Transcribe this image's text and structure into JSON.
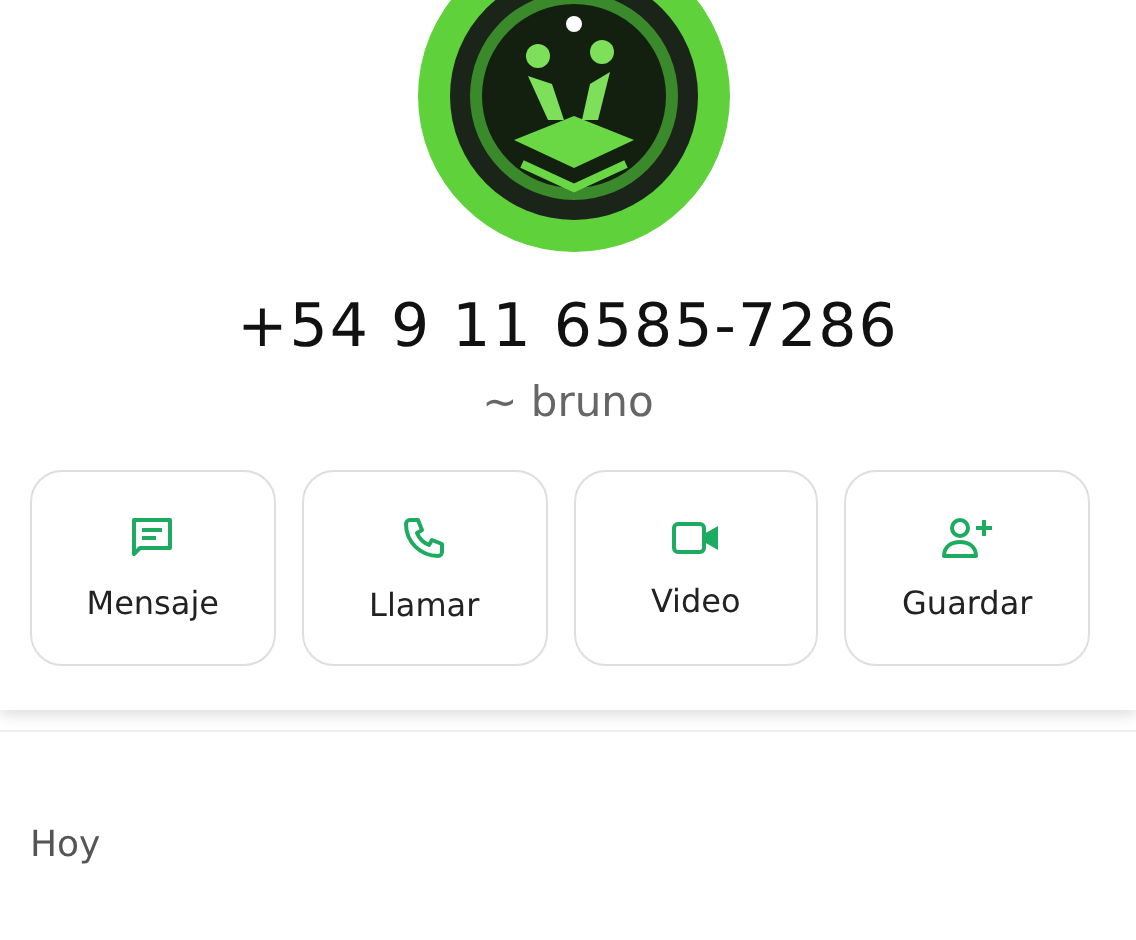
{
  "contact": {
    "phone": "+54 9 11 6585-7286",
    "name": "~ bruno"
  },
  "actions": [
    {
      "kind": "message",
      "label": "Mensaje"
    },
    {
      "kind": "call",
      "label": "Llamar"
    },
    {
      "kind": "video",
      "label": "Video"
    },
    {
      "kind": "add-contact",
      "label": "Guardar"
    }
  ],
  "section": {
    "title": "Hoy"
  }
}
